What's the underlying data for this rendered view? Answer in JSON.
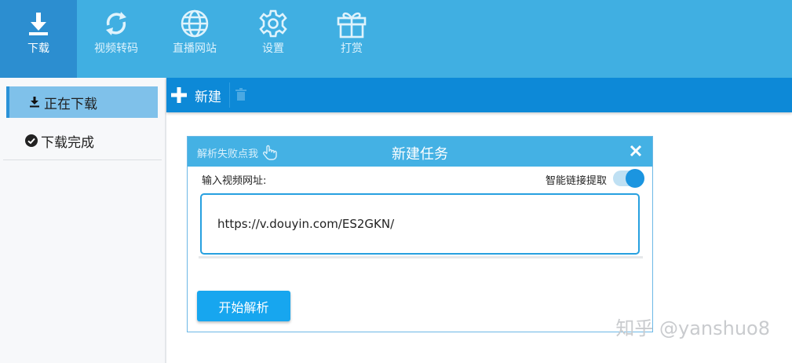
{
  "topbar": {
    "items": [
      {
        "label": "下载",
        "icon": "download-icon",
        "active": true
      },
      {
        "label": "视频转码",
        "icon": "convert-icon",
        "active": false
      },
      {
        "label": "直播网站",
        "icon": "globe-icon",
        "active": false
      },
      {
        "label": "设置",
        "icon": "gear-icon",
        "active": false
      },
      {
        "label": "打赏",
        "icon": "gift-icon",
        "active": false
      }
    ]
  },
  "sidebar": {
    "items": [
      {
        "label": "正在下载",
        "icon": "download-arrow-icon",
        "active": true
      },
      {
        "label": "下载完成",
        "icon": "check-circle-icon",
        "active": false
      }
    ]
  },
  "toolbar": {
    "new_label": "新建"
  },
  "dialog": {
    "retry_label": "解析失败点我",
    "title": "新建任务",
    "url_label": "输入视频网址:",
    "smart_label": "智能链接提取",
    "smart_enabled": true,
    "url_value": "https://v.douyin.com/ES2GKN/",
    "start_label": "开始解析"
  },
  "watermark": "知乎 @yanshuo8",
  "colors": {
    "topbar": "#40afe2",
    "topbar_active": "#2c8ed0",
    "toolbar": "#0d89d7",
    "accent": "#17a6ef",
    "sidebar_active": "#7fc1ea"
  }
}
